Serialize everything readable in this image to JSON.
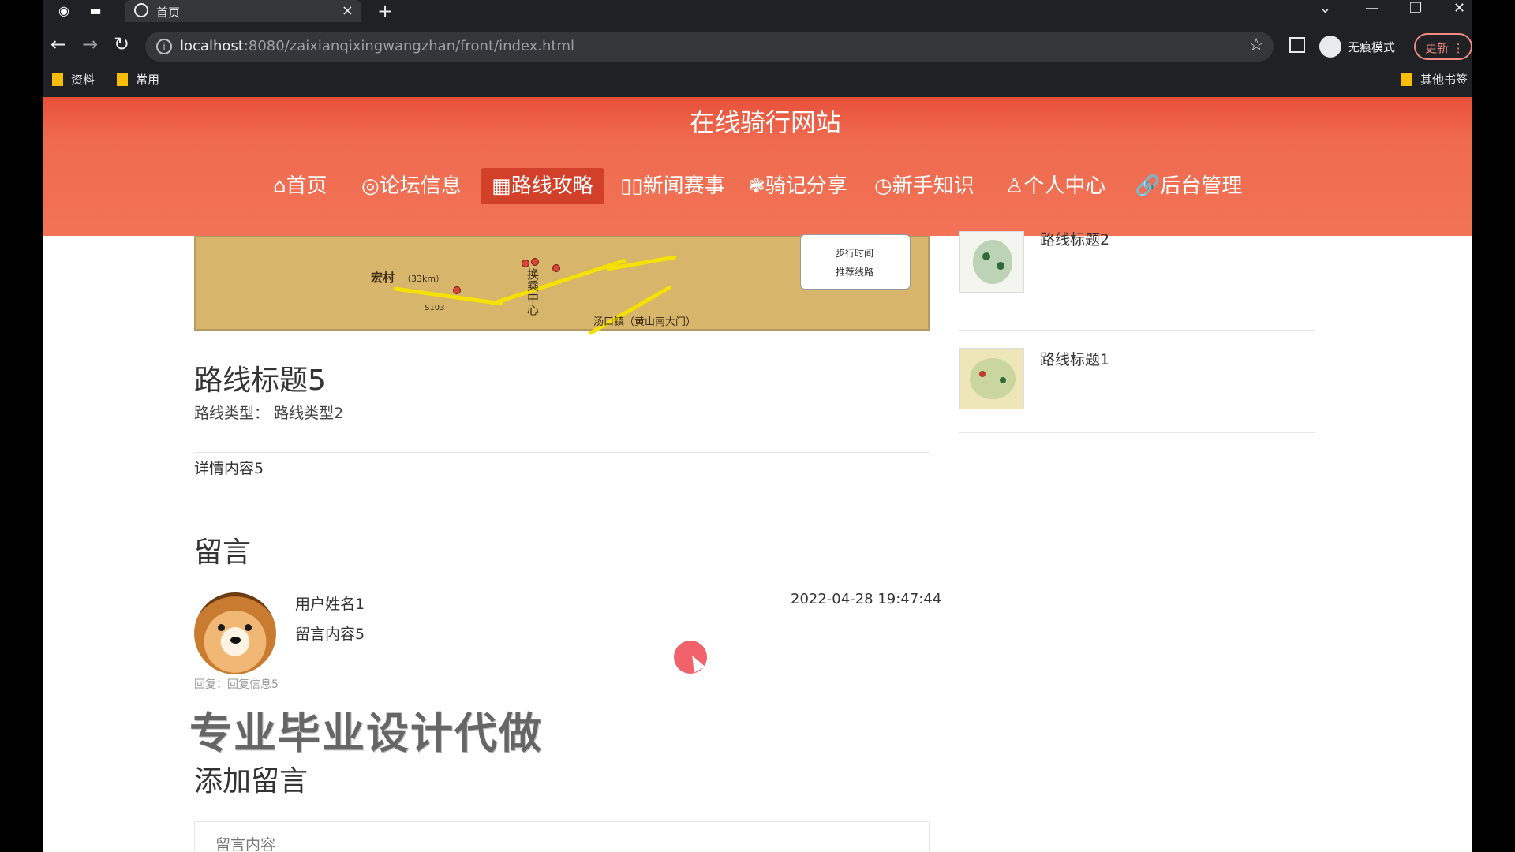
{
  "browser": {
    "tab_title": "首页",
    "tab_close": "×",
    "new_tab": "+",
    "url_host": "localhost",
    "url_path": ":8080/zaixianqixingwangzhan/front/index.html",
    "incognito_label": "无痕模式",
    "update_label": "更新",
    "bookmarks": [
      "资料",
      "常用"
    ],
    "other_bookmarks": "其他书签"
  },
  "site": {
    "title": "在线骑行网站",
    "nav": [
      {
        "icon": "⌂",
        "label": "首页"
      },
      {
        "icon": "◎",
        "label": "论坛信息"
      },
      {
        "icon": "▦",
        "label": "路线攻略"
      },
      {
        "icon": "▯▯",
        "label": "新闻赛事"
      },
      {
        "icon": "❃",
        "label": "骑记分享"
      },
      {
        "icon": "◷",
        "label": "新手知识"
      },
      {
        "icon": "♙",
        "label": "个人中心"
      },
      {
        "icon": "🔗",
        "label": "后台管理"
      }
    ],
    "active_nav": "路线攻略"
  },
  "map": {
    "labels": {
      "village": "宏村",
      "distance": "（33km）",
      "vertical": "换乘中心",
      "town": "汤口镇（黄山南大门）",
      "road": "S103",
      "legend_walk": "步行时间",
      "legend_route": "推荐线路"
    }
  },
  "detail": {
    "title": "路线标题5",
    "type_label": "路线类型：",
    "type_value": "路线类型2",
    "body": "详情内容5"
  },
  "comments": {
    "heading": "留言",
    "items": [
      {
        "user": "用户姓名1",
        "content": "留言内容5",
        "time": "2022-04-28 19:47:44",
        "reply_label": "回复：",
        "reply": "回复信息5"
      }
    ]
  },
  "watermark": "专业毕业设计代做",
  "add_comment": {
    "heading": "添加留言",
    "placeholder": "留言内容"
  },
  "sidebar": {
    "items": [
      {
        "title": "路线标题2"
      },
      {
        "title": "路线标题1"
      }
    ]
  }
}
